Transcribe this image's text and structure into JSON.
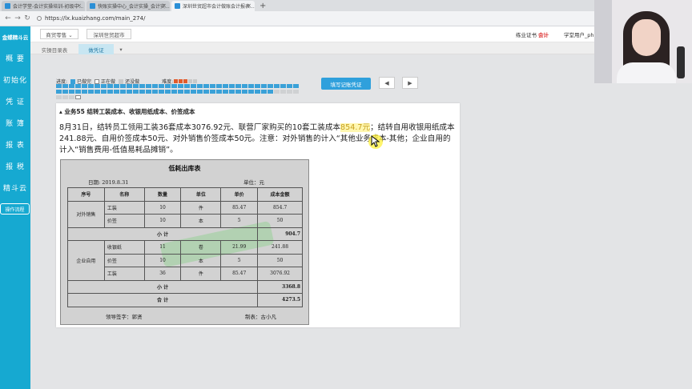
{
  "browser": {
    "tabs": [
      {
        "label": "会计学堂-会计实操培训-初级中..."
      },
      {
        "label": "快账实操中心_会计实操_会计实..."
      },
      {
        "label": "深圳世贸超市会计做账会计报表..."
      }
    ],
    "url": "https://lx.kuaizhang.com/main_274/"
  },
  "sidebar": {
    "logo": "金蝶精斗云",
    "items": [
      {
        "label": "概 要"
      },
      {
        "label": "初始化"
      },
      {
        "label": "凭 证"
      },
      {
        "label": "账 簿"
      },
      {
        "label": "报 表"
      },
      {
        "label": "报 税"
      },
      {
        "label": "精斗云"
      }
    ],
    "flow_button": "操作流程"
  },
  "header": {
    "dropdown": "商贸零售 ⌄",
    "company": "深圳世贸超市",
    "cert": "练业证书",
    "cert_badge": "会计",
    "user": "学堂用户_ph1"
  },
  "subtabs": [
    {
      "label": "实操目录表"
    },
    {
      "label": "做凭证"
    }
  ],
  "progress": {
    "label": "进度:",
    "done": "已做完",
    "doing": "正在做",
    "todo": "还没做",
    "difficulty": "难度:"
  },
  "actions": {
    "fill_voucher": "填写记账凭证",
    "prev": "◀",
    "next": "▶"
  },
  "task": {
    "title": "业务55 结转工装成本、收银用纸成本、价签成本",
    "desc_before": "8月31日，结转员工领用工装36套成本3076.92元、联营厂家购买的10套工装成本",
    "desc_highlight": "854.7元",
    "desc_after": "；结转自用收银用纸成本241.88元、自用价签成本50元、对外销售价签成本50元。注意：对外销售的计入“其他业务成本-其他；企业自用的计入“销售费用-低值易耗品摊销”。"
  },
  "doc": {
    "title": "低耗出库表",
    "date": "日期:  2019.8.31",
    "unit": "单位：元",
    "headers": [
      "序号",
      "名称",
      "数量",
      "单位",
      "单价",
      "成本金额"
    ],
    "group1": "对外销售",
    "group2": "企业自用",
    "rows1": [
      {
        "name": "工装",
        "qty": "10",
        "unit": "件",
        "price": "85.47",
        "amount": "854.7"
      },
      {
        "name": "价签",
        "qty": "10",
        "unit": "本",
        "price": "5",
        "amount": "50"
      }
    ],
    "subtotal1": "904.7",
    "rows2": [
      {
        "name": "收银纸",
        "qty": "11",
        "unit": "卷",
        "price": "21.99",
        "amount": "241.88"
      },
      {
        "name": "价签",
        "qty": "10",
        "unit": "本",
        "price": "5",
        "amount": "50"
      },
      {
        "name": "工装",
        "qty": "36",
        "unit": "件",
        "price": "85.47",
        "amount": "3076.92"
      }
    ],
    "subtotal2": "3368.8",
    "total": "4273.5",
    "subtotal_label": "小    计",
    "total_label": "合    计",
    "signer": "领导签字：郭贤",
    "maker": "制表：古小凡"
  }
}
